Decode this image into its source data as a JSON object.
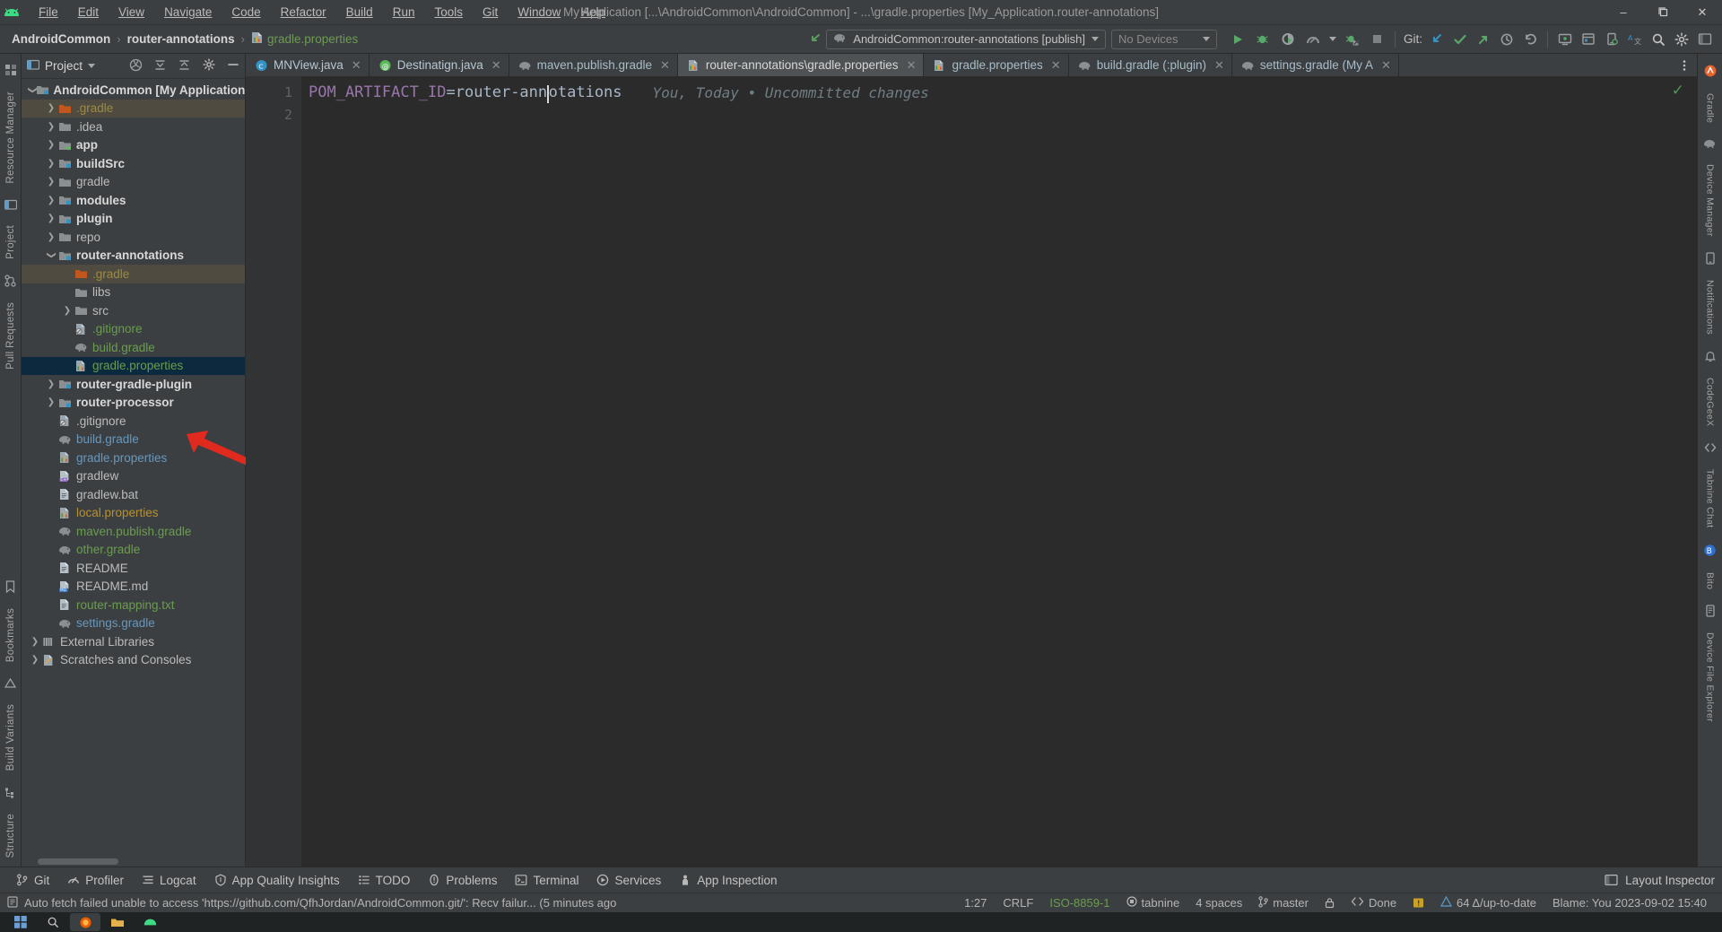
{
  "window": {
    "title": "My Application [...\\AndroidCommon\\AndroidCommon] - ...\\gradle.properties [My_Application.router-annotations]",
    "minimize": "–",
    "maximize": "❐",
    "close": "✕"
  },
  "menu": [
    {
      "label": "File"
    },
    {
      "label": "Edit"
    },
    {
      "label": "View"
    },
    {
      "label": "Navigate"
    },
    {
      "label": "Code"
    },
    {
      "label": "Refactor"
    },
    {
      "label": "Build"
    },
    {
      "label": "Run"
    },
    {
      "label": "Tools"
    },
    {
      "label": "Git"
    },
    {
      "label": "Window"
    },
    {
      "label": "Help"
    }
  ],
  "breadcrumb": {
    "project": "AndroidCommon",
    "module": "router-annotations",
    "file": "gradle.properties",
    "separator": "›"
  },
  "toolbar": {
    "run_config": "AndroidCommon:router-annotations [publish]",
    "device": "No Devices",
    "git_label": "Git:"
  },
  "project_panel": {
    "title": "Project",
    "tree": [
      {
        "depth": 0,
        "arrow": "down",
        "icon": "module-folder",
        "label": "AndroidCommon [My Application]",
        "color": "c-white",
        "bold": true,
        "state": ""
      },
      {
        "depth": 1,
        "arrow": "right",
        "icon": "folder-orange",
        "label": ".gradle",
        "color": "c-olive",
        "bold": false,
        "state": "hl-gradle"
      },
      {
        "depth": 1,
        "arrow": "right",
        "icon": "folder-grey",
        "label": ".idea",
        "color": "c-grey",
        "bold": false,
        "state": ""
      },
      {
        "depth": 1,
        "arrow": "right",
        "icon": "module-green",
        "label": "app",
        "color": "c-white",
        "bold": true,
        "state": ""
      },
      {
        "depth": 1,
        "arrow": "right",
        "icon": "module-folder",
        "label": "buildSrc",
        "color": "c-white",
        "bold": true,
        "state": ""
      },
      {
        "depth": 1,
        "arrow": "right",
        "icon": "folder-grey",
        "label": "gradle",
        "color": "c-grey",
        "bold": false,
        "state": ""
      },
      {
        "depth": 1,
        "arrow": "right",
        "icon": "module-folder",
        "label": "modules",
        "color": "c-white",
        "bold": true,
        "state": ""
      },
      {
        "depth": 1,
        "arrow": "right",
        "icon": "module-folder",
        "label": "plugin",
        "color": "c-white",
        "bold": true,
        "state": ""
      },
      {
        "depth": 1,
        "arrow": "right",
        "icon": "folder-grey",
        "label": "repo",
        "color": "c-grey",
        "bold": false,
        "state": ""
      },
      {
        "depth": 1,
        "arrow": "down",
        "icon": "module-folder",
        "label": "router-annotations",
        "color": "c-white",
        "bold": true,
        "state": ""
      },
      {
        "depth": 2,
        "arrow": "none",
        "icon": "folder-orange",
        "label": ".gradle",
        "color": "c-olive",
        "bold": false,
        "state": "hl-gradle"
      },
      {
        "depth": 2,
        "arrow": "none",
        "icon": "folder-grey",
        "label": "libs",
        "color": "c-grey",
        "bold": false,
        "state": ""
      },
      {
        "depth": 2,
        "arrow": "right",
        "icon": "folder-grey",
        "label": "src",
        "color": "c-grey",
        "bold": false,
        "state": ""
      },
      {
        "depth": 2,
        "arrow": "none",
        "icon": "gitignore-file",
        "label": ".gitignore",
        "color": "c-green",
        "bold": false,
        "state": ""
      },
      {
        "depth": 2,
        "arrow": "none",
        "icon": "gradle-file",
        "label": "build.gradle",
        "color": "c-green",
        "bold": false,
        "state": ""
      },
      {
        "depth": 2,
        "arrow": "none",
        "icon": "properties-file",
        "label": "gradle.properties",
        "color": "c-green",
        "bold": false,
        "state": "selected"
      },
      {
        "depth": 1,
        "arrow": "right",
        "icon": "module-folder",
        "label": "router-gradle-plugin",
        "color": "c-white",
        "bold": true,
        "state": ""
      },
      {
        "depth": 1,
        "arrow": "right",
        "icon": "module-folder",
        "label": "router-processor",
        "color": "c-white",
        "bold": true,
        "state": ""
      },
      {
        "depth": 1,
        "arrow": "none",
        "icon": "gitignore-file",
        "label": ".gitignore",
        "color": "c-grey",
        "bold": false,
        "state": ""
      },
      {
        "depth": 1,
        "arrow": "none",
        "icon": "gradle-file",
        "label": "build.gradle",
        "color": "c-blue",
        "bold": false,
        "state": ""
      },
      {
        "depth": 1,
        "arrow": "none",
        "icon": "properties-file",
        "label": "gradle.properties",
        "color": "c-blue",
        "bold": false,
        "state": ""
      },
      {
        "depth": 1,
        "arrow": "none",
        "icon": "cpp-file",
        "label": "gradlew",
        "color": "c-grey",
        "bold": false,
        "state": ""
      },
      {
        "depth": 1,
        "arrow": "none",
        "icon": "text-file",
        "label": "gradlew.bat",
        "color": "c-grey",
        "bold": false,
        "state": ""
      },
      {
        "depth": 1,
        "arrow": "none",
        "icon": "properties-file",
        "label": "local.properties",
        "color": "c-orange",
        "bold": false,
        "state": ""
      },
      {
        "depth": 1,
        "arrow": "none",
        "icon": "gradle-file",
        "label": "maven.publish.gradle",
        "color": "c-green",
        "bold": false,
        "state": ""
      },
      {
        "depth": 1,
        "arrow": "none",
        "icon": "gradle-file",
        "label": "other.gradle",
        "color": "c-green",
        "bold": false,
        "state": ""
      },
      {
        "depth": 1,
        "arrow": "none",
        "icon": "text-file",
        "label": "README",
        "color": "c-grey",
        "bold": false,
        "state": ""
      },
      {
        "depth": 1,
        "arrow": "none",
        "icon": "md-file",
        "label": "README.md",
        "color": "c-grey",
        "bold": false,
        "state": ""
      },
      {
        "depth": 1,
        "arrow": "none",
        "icon": "text-file",
        "label": "router-mapping.txt",
        "color": "c-green",
        "bold": false,
        "state": ""
      },
      {
        "depth": 1,
        "arrow": "none",
        "icon": "gradle-file",
        "label": "settings.gradle",
        "color": "c-blue",
        "bold": false,
        "state": ""
      },
      {
        "depth": 0,
        "arrow": "right",
        "icon": "libraries",
        "label": "External Libraries",
        "color": "c-grey",
        "bold": false,
        "state": ""
      },
      {
        "depth": 0,
        "arrow": "right",
        "icon": "scratches",
        "label": "Scratches and Consoles",
        "color": "c-grey",
        "bold": false,
        "state": ""
      }
    ]
  },
  "left_strip": [
    {
      "label": "Resource Manager"
    },
    {
      "label": "Project"
    },
    {
      "label": "Pull Requests"
    },
    {
      "label": "Bookmarks"
    },
    {
      "label": "Build Variants"
    },
    {
      "label": "Structure"
    }
  ],
  "right_strip": [
    {
      "label": "Gradle"
    },
    {
      "label": "Device Manager"
    },
    {
      "label": "Notifications"
    },
    {
      "label": "CodeGeeX"
    },
    {
      "label": "Tabnine Chat"
    },
    {
      "label": "Bito"
    },
    {
      "label": "Device File Explorer"
    }
  ],
  "tabs": [
    {
      "label": "MNView.java",
      "icon": "class-icon",
      "active": false
    },
    {
      "label": "Destinatign.java",
      "icon": "annotation-icon",
      "active": false
    },
    {
      "label": "maven.publish.gradle",
      "icon": "gradle-icon",
      "active": false
    },
    {
      "label": "router-annotations\\gradle.properties",
      "icon": "properties-icon",
      "active": true
    },
    {
      "label": "gradle.properties",
      "icon": "properties-icon",
      "active": false
    },
    {
      "label": "build.gradle (:plugin)",
      "icon": "gradle-icon",
      "active": false
    },
    {
      "label": "settings.gradle (My A",
      "icon": "gradle-icon",
      "active": false
    }
  ],
  "editor": {
    "line_numbers": [
      "1",
      "2"
    ],
    "code_key": "POM_ARTIFACT_ID",
    "code_eq": "=",
    "code_value_before": "router-ann",
    "code_value_after": "otations",
    "blame": "You, Today • Uncommitted changes",
    "ok_check": "✓"
  },
  "tool_buttons": [
    {
      "label": "Git",
      "icon": "git-branch-icon"
    },
    {
      "label": "Profiler",
      "icon": "profiler-icon"
    },
    {
      "label": "Logcat",
      "icon": "logcat-icon"
    },
    {
      "label": "App Quality Insights",
      "icon": "shield-icon"
    },
    {
      "label": "TODO",
      "icon": "todo-icon"
    },
    {
      "label": "Problems",
      "icon": "problems-icon"
    },
    {
      "label": "Terminal",
      "icon": "terminal-icon"
    },
    {
      "label": "Services",
      "icon": "services-icon"
    },
    {
      "label": "App Inspection",
      "icon": "inspection-icon"
    }
  ],
  "tool_right": {
    "layout_inspector": "Layout Inspector"
  },
  "status": {
    "message": "Auto fetch failed unable to access 'https://github.com/QfhJordan/AndroidCommon.git/': Recv failur... (5 minutes ago",
    "caret": "1:27",
    "line_sep": "CRLF",
    "encoding": "ISO-8859-1",
    "tabnine": "tabnine",
    "indent": "4 spaces",
    "branch": "master",
    "done": "Done",
    "memory": "64 Δ/up-to-date",
    "blame": "Blame: You 2023-09-02 15:40"
  },
  "colors": {
    "accent_green": "#6a9c4f",
    "selection_blue": "#0d293e",
    "highlight_khaki": "#4f4b41",
    "arrow_red": "#e02a1d",
    "panel_bg": "#3c3f41",
    "editor_bg": "#2b2b2b"
  }
}
